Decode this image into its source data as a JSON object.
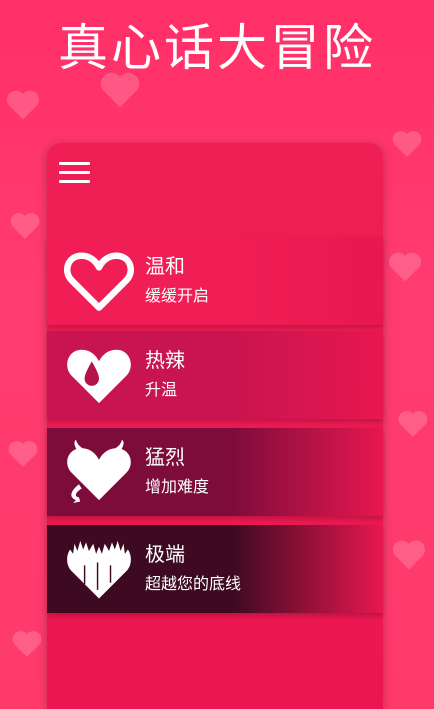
{
  "app": {
    "title": "真心话大冒险"
  },
  "menu": {
    "icon": "hamburger-menu-icon"
  },
  "levels": [
    {
      "name": "温和",
      "desc": "缓缓开启",
      "icon": "heart-outline-icon",
      "color": "#f01e55"
    },
    {
      "name": "热辣",
      "desc": "升温",
      "icon": "heart-drop-icon",
      "color": "#c81450"
    },
    {
      "name": "猛烈",
      "desc": "增加难度",
      "icon": "devil-heart-icon",
      "color": "#7d0c3a"
    },
    {
      "name": "极端",
      "desc": "超越您的底线",
      "icon": "flame-heart-icon",
      "color": "#3d0a22"
    }
  ]
}
